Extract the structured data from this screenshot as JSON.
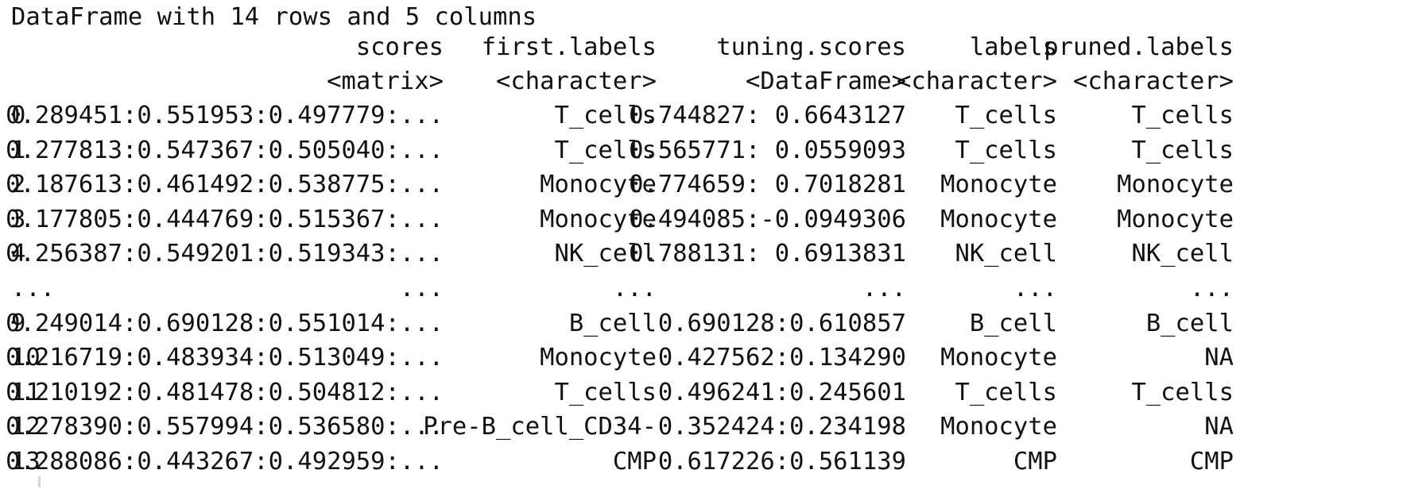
{
  "summary": "DataFrame with 14 rows and 5 columns",
  "columns": [
    "scores",
    "first.labels",
    "tuning.scores",
    "labels",
    "pruned.labels"
  ],
  "types": [
    "<matrix>",
    "<character>",
    "<DataFrame>",
    "<character>",
    "<character>"
  ],
  "rows": [
    {
      "index": "0",
      "scores": "0.289451:0.551953:0.497779:...",
      "first_labels": "T_cells",
      "tuning_scores": "0.744827: 0.6643127",
      "labels": "T_cells",
      "pruned_labels": "T_cells"
    },
    {
      "index": "1",
      "scores": "0.277813:0.547367:0.505040:...",
      "first_labels": "T_cells",
      "tuning_scores": "0.565771: 0.0559093",
      "labels": "T_cells",
      "pruned_labels": "T_cells"
    },
    {
      "index": "2",
      "scores": "0.187613:0.461492:0.538775:...",
      "first_labels": "Monocyte",
      "tuning_scores": "0.774659: 0.7018281",
      "labels": "Monocyte",
      "pruned_labels": "Monocyte"
    },
    {
      "index": "3",
      "scores": "0.177805:0.444769:0.515367:...",
      "first_labels": "Monocyte",
      "tuning_scores": "0.494085:-0.0949306",
      "labels": "Monocyte",
      "pruned_labels": "Monocyte"
    },
    {
      "index": "4",
      "scores": "0.256387:0.549201:0.519343:...",
      "first_labels": "NK_cell",
      "tuning_scores": "0.788131: 0.6913831",
      "labels": "NK_cell",
      "pruned_labels": "NK_cell"
    },
    {
      "index": "...",
      "scores": "...",
      "first_labels": "...",
      "tuning_scores": "...",
      "labels": "...",
      "pruned_labels": "..."
    },
    {
      "index": "9",
      "scores": "0.249014:0.690128:0.551014:...",
      "first_labels": "B_cell",
      "tuning_scores": "0.690128:0.610857",
      "labels": "B_cell",
      "pruned_labels": "B_cell"
    },
    {
      "index": "10",
      "scores": "0.216719:0.483934:0.513049:...",
      "first_labels": "Monocyte",
      "tuning_scores": "0.427562:0.134290",
      "labels": "Monocyte",
      "pruned_labels": "NA"
    },
    {
      "index": "11",
      "scores": "0.210192:0.481478:0.504812:...",
      "first_labels": "T_cells",
      "tuning_scores": "0.496241:0.245601",
      "labels": "T_cells",
      "pruned_labels": "T_cells"
    },
    {
      "index": "12",
      "scores": "0.278390:0.557994:0.536580:...",
      "first_labels": "Pre-B_cell_CD34-",
      "tuning_scores": "0.352424:0.234198",
      "labels": "Monocyte",
      "pruned_labels": "NA"
    },
    {
      "index": "13",
      "scores": "0.288086:0.443267:0.492959:...",
      "first_labels": "CMP",
      "tuning_scores": "0.617226:0.561139",
      "labels": "CMP",
      "pruned_labels": "CMP"
    }
  ]
}
